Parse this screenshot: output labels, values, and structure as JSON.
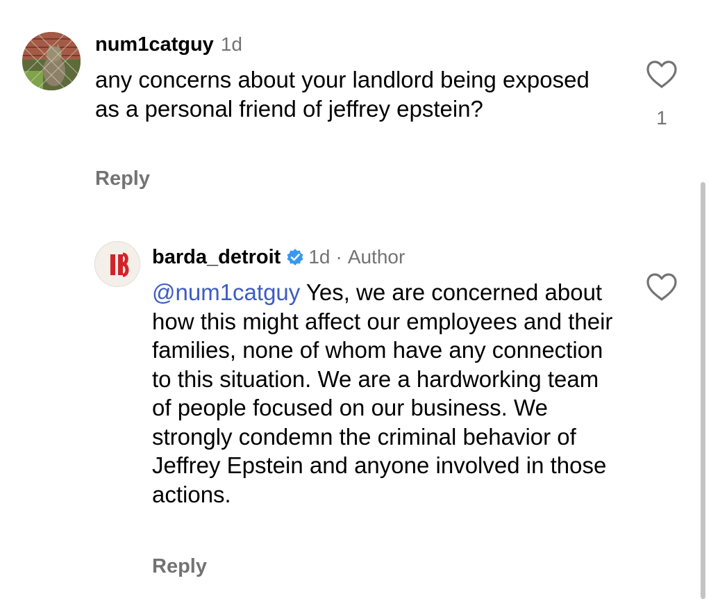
{
  "comments": [
    {
      "username": "num1catguy",
      "time": "1d",
      "text": "any concerns about your landlord being exposed as a personal friend of jeffrey epstein?",
      "reply_label": "Reply",
      "like_count": "1",
      "avatar_icon": "cat-photo-avatar-icon"
    },
    {
      "username": "barda_detroit",
      "time": "1d",
      "separator": "·",
      "author_label": "Author",
      "mention": "@num1catguy",
      "text": " Yes, we are concerned about how this might affect our employees and their families, none of whom have any connection to this situation. We are a hardworking team of people focused on our business. We strongly condemn the criminal behavior of Jeffrey Epstein and anyone involved in those actions.",
      "reply_label": "Reply",
      "avatar_icon": "barda-logo-avatar-icon",
      "verified_icon": "verified-badge-icon"
    }
  ],
  "colors": {
    "text": "#000000",
    "secondary": "#737373",
    "mention": "#3d5cc4",
    "verified": "#3897f0",
    "logo_red": "#d2232a"
  }
}
